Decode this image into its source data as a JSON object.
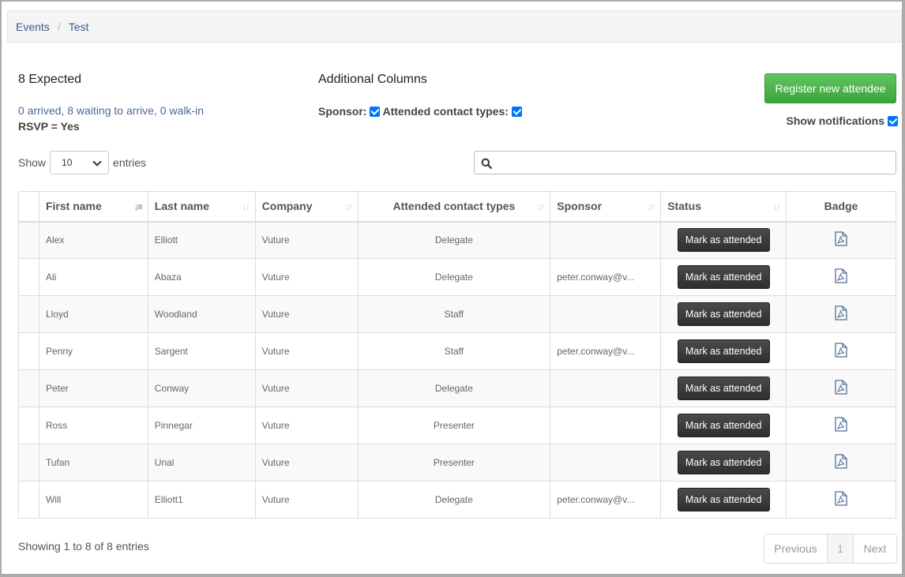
{
  "breadcrumb": {
    "items": [
      "Events",
      "Test"
    ],
    "separator": "/"
  },
  "summary": {
    "expected": "8 Expected",
    "arrival_text": "0 arrived, 8 waiting to arrive, 0 walk-in",
    "rsvp": "RSVP = Yes"
  },
  "additional_columns": {
    "title": "Additional Columns",
    "sponsor_label": "Sponsor:",
    "sponsor_checked": true,
    "contact_types_label": "Attended contact types:",
    "contact_types_checked": true
  },
  "register_button": "Register new attendee",
  "show_notifications": {
    "label": "Show notifications",
    "checked": true
  },
  "length": {
    "show": "Show",
    "value": "10",
    "entries": "entries"
  },
  "search": {
    "placeholder": ""
  },
  "table": {
    "headers": [
      "First name",
      "Last name",
      "Company",
      "Attended contact types",
      "Sponsor",
      "Status",
      "Badge"
    ],
    "action_label": "Mark as attended",
    "rows": [
      {
        "first": "Alex",
        "last": "Elliott",
        "company": "Vuture",
        "type": "Delegate",
        "sponsor": ""
      },
      {
        "first": "Ali",
        "last": "Abaza",
        "company": "Vuture",
        "type": "Delegate",
        "sponsor": "peter.conway@v..."
      },
      {
        "first": "Lloyd",
        "last": "Woodland",
        "company": "Vuture",
        "type": "Staff",
        "sponsor": ""
      },
      {
        "first": "Penny",
        "last": "Sargent",
        "company": "Vuture",
        "type": "Staff",
        "sponsor": "peter.conway@v..."
      },
      {
        "first": "Peter",
        "last": "Conway",
        "company": "Vuture",
        "type": "Delegate",
        "sponsor": ""
      },
      {
        "first": "Ross",
        "last": "Pinnegar",
        "company": "Vuture",
        "type": "Presenter",
        "sponsor": ""
      },
      {
        "first": "Tufan",
        "last": "Unal",
        "company": "Vuture",
        "type": "Presenter",
        "sponsor": ""
      },
      {
        "first": "Will",
        "last": "Elliott1",
        "company": "Vuture",
        "type": "Delegate",
        "sponsor": "peter.conway@v..."
      }
    ]
  },
  "footer": {
    "info": "Showing 1 to 8 of 8 entries",
    "previous": "Previous",
    "page": "1",
    "next": "Next"
  },
  "icons": {
    "search": "search-icon",
    "badge": "pdf-file-icon",
    "sort": "sort-icon"
  }
}
